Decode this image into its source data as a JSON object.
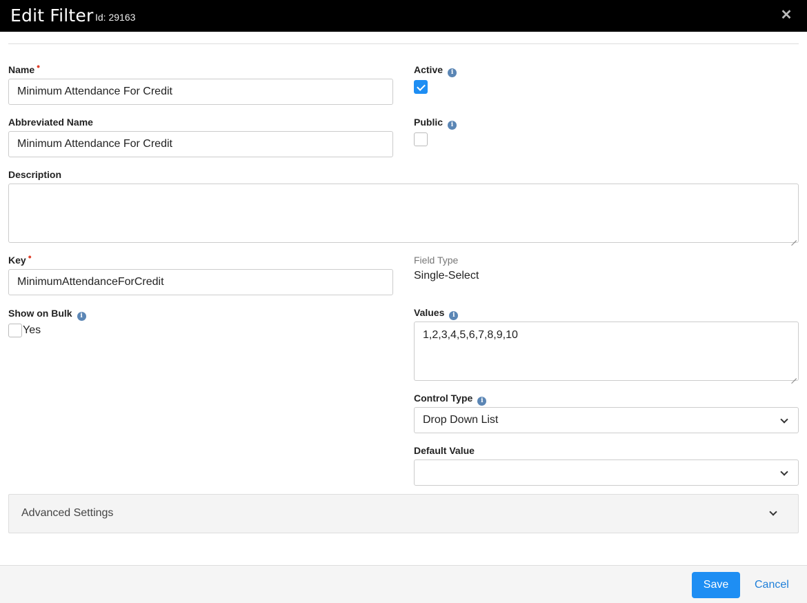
{
  "header": {
    "title": "Edit Filter",
    "id_label": "Id: 29163",
    "close": "✕"
  },
  "fields": {
    "name": {
      "label": "Name",
      "required": "•",
      "value": "Minimum Attendance For Credit"
    },
    "abbreviated_name": {
      "label": "Abbreviated Name",
      "value": "Minimum Attendance For Credit"
    },
    "description": {
      "label": "Description",
      "value": ""
    },
    "key": {
      "label": "Key",
      "required": "•",
      "value": "MinimumAttendanceForCredit"
    },
    "show_on_bulk": {
      "label": "Show on Bulk",
      "option": "Yes",
      "checked": false
    },
    "active": {
      "label": "Active",
      "checked": true
    },
    "public": {
      "label": "Public",
      "checked": false
    },
    "field_type": {
      "label": "Field Type",
      "value": "Single-Select"
    },
    "values": {
      "label": "Values",
      "value": "1,2,3,4,5,6,7,8,9,10"
    },
    "control_type": {
      "label": "Control Type",
      "value": "Drop Down List"
    },
    "default_value": {
      "label": "Default Value",
      "value": ""
    }
  },
  "info_glyph": "i",
  "advanced": {
    "label": "Advanced Settings"
  },
  "footer": {
    "save": "Save",
    "cancel": "Cancel"
  },
  "colors": {
    "accent": "#1e8ef3",
    "required": "#e0412c",
    "info": "#5b86b5"
  }
}
